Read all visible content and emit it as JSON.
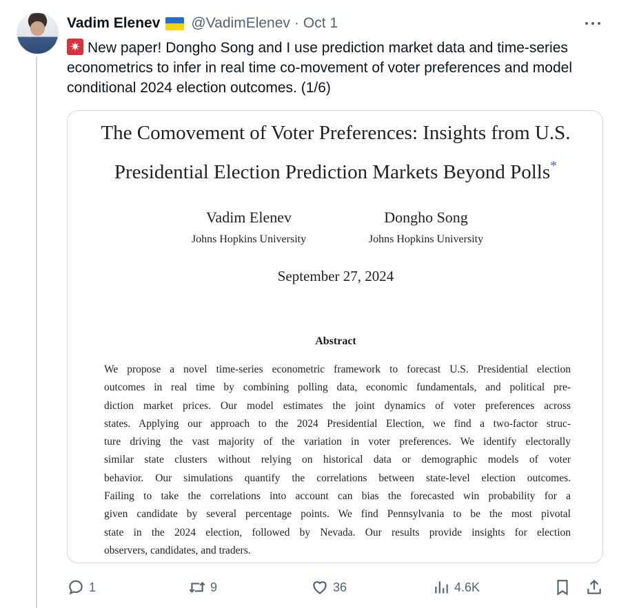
{
  "tweet": {
    "display_name": "Vadim Elenev",
    "handle": "@VadimElenev",
    "separator": "·",
    "date": "Oct 1",
    "text": "New paper! Dongho Song and I use prediction market data and time-series econometrics to infer in real time co-movement of voter preferences and model conditional 2024 election outcomes. (1/6)",
    "emoji_icon": "rotating-light-icon",
    "flag_icon": "ukraine-flag-icon"
  },
  "paper": {
    "title_line1": "The Comovement of Voter Preferences: Insights from U.S.",
    "title_line2": "Presidential Election Prediction Markets Beyond Polls",
    "title_mark": "*",
    "authors": [
      {
        "name": "Vadim Elenev",
        "affiliation": "Johns Hopkins University"
      },
      {
        "name": "Dongho Song",
        "affiliation": "Johns Hopkins University"
      }
    ],
    "date": "September 27, 2024",
    "abstract_heading": "Abstract",
    "abstract_lines": [
      "We propose a novel time-series econometric framework to forecast U.S. Presidential election",
      "outcomes in real time by combining polling data, economic fundamentals, and political pre-",
      "diction market prices. Our model estimates the joint dynamics of voter preferences across",
      "states. Applying our approach to the 2024 Presidential Election, we find a two-factor struc-",
      "ture driving the vast majority of the variation in voter preferences. We identify electorally",
      "similar state clusters without relying on historical data or demographic models of voter",
      "behavior. Our simulations quantify the correlations between state-level election outcomes.",
      "Failing to take the correlations into account can bias the forecasted win probability for a",
      "given candidate by several percentage points. We find Pennsylvania to be the most pivotal",
      "state in the 2024 election, followed by Nevada. Our results provide insights for election",
      "observers, candidates, and traders."
    ]
  },
  "actions": {
    "replies": "1",
    "retweets": "9",
    "likes": "36",
    "views": "4.6K"
  },
  "colors": {
    "text": "#0f1419",
    "muted": "#536471",
    "border": "#cfd9de"
  }
}
